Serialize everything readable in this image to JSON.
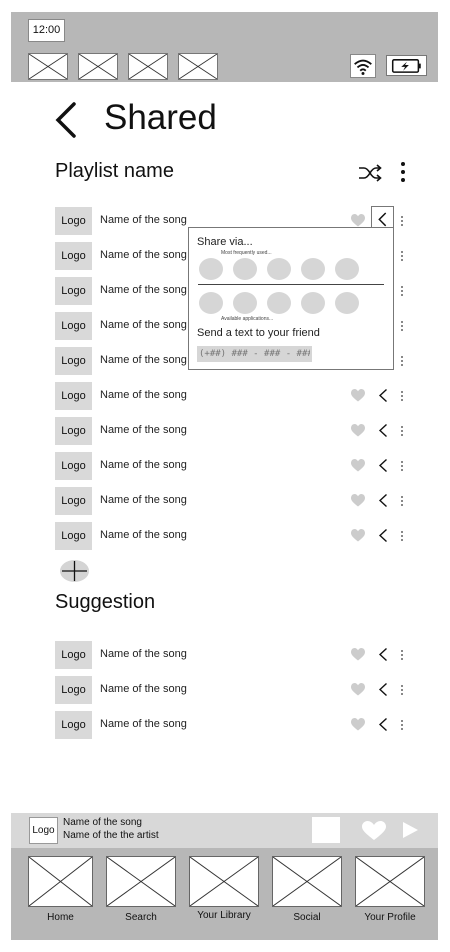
{
  "status_bar": {
    "time": "12:00",
    "placeholders": [
      "image-placeholder",
      "image-placeholder",
      "image-placeholder",
      "image-placeholder"
    ],
    "wifi_icon": "wifi-icon",
    "battery_icon": "battery-charging-icon"
  },
  "header": {
    "back_icon": "chevron-left-icon",
    "title": "Shared"
  },
  "playlist": {
    "name": "Playlist name",
    "shuffle_icon": "shuffle-icon",
    "more_icon": "more-vertical-icon",
    "songs": [
      {
        "logo": "Logo",
        "title": "Name of the song"
      },
      {
        "logo": "Logo",
        "title": "Name of the song"
      },
      {
        "logo": "Logo",
        "title": "Name of the song"
      },
      {
        "logo": "Logo",
        "title": "Name of the song"
      },
      {
        "logo": "Logo",
        "title": "Name of the song"
      },
      {
        "logo": "Logo",
        "title": "Name of the song"
      },
      {
        "logo": "Logo",
        "title": "Name of the song"
      },
      {
        "logo": "Logo",
        "title": "Name of the song"
      },
      {
        "logo": "Logo",
        "title": "Name of the song"
      },
      {
        "logo": "Logo",
        "title": "Name of the song"
      }
    ],
    "add_icon": "plus-icon"
  },
  "share_popup": {
    "title": "Share via...",
    "frequent_caption": "Most frequently used...",
    "available_caption": "Available applications...",
    "send_text": "Send a text to your friend",
    "phone_placeholder": "(+##) ### - ### - ####"
  },
  "suggestion": {
    "title": "Suggestion",
    "songs": [
      {
        "logo": "Logo",
        "title": "Name of the song"
      },
      {
        "logo": "Logo",
        "title": "Name of the song"
      },
      {
        "logo": "Logo",
        "title": "Name of the song"
      }
    ]
  },
  "now_playing": {
    "logo": "Logo",
    "song": "Name of the song",
    "artist": "Name of the the artist"
  },
  "tab_bar": {
    "tabs": [
      {
        "label": "Home"
      },
      {
        "label": "Search"
      },
      {
        "label": "Your Library"
      },
      {
        "label": "Social"
      },
      {
        "label": "Your Profile"
      }
    ]
  },
  "colors": {
    "bar_gray": "#b7b7b7",
    "logo_gray": "#d9d9d9",
    "icon_gray": "#cccccc",
    "text": "#222222"
  }
}
